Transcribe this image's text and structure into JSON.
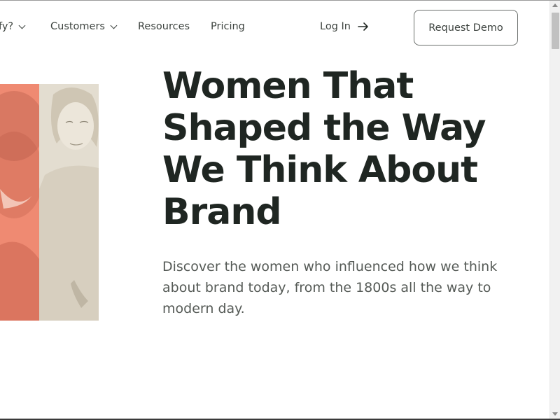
{
  "nav": {
    "items": [
      {
        "label": "fy?",
        "has_dropdown": true
      },
      {
        "label": "Customers",
        "has_dropdown": true
      },
      {
        "label": "Resources",
        "has_dropdown": false
      },
      {
        "label": "Pricing",
        "has_dropdown": false
      }
    ],
    "login_label": "Log In",
    "login_icon": "arrow-right-icon",
    "demo_label": "Request Demo"
  },
  "hero": {
    "title": "Women That Shaped the Way We Think About Brand",
    "subtitle": "Discover the women who influenced how we think about brand today, from the 1800s all the way to modern day."
  },
  "colors": {
    "coral": "#ef8a72",
    "beige": "#e3ddd0",
    "text": "#1f2622"
  }
}
